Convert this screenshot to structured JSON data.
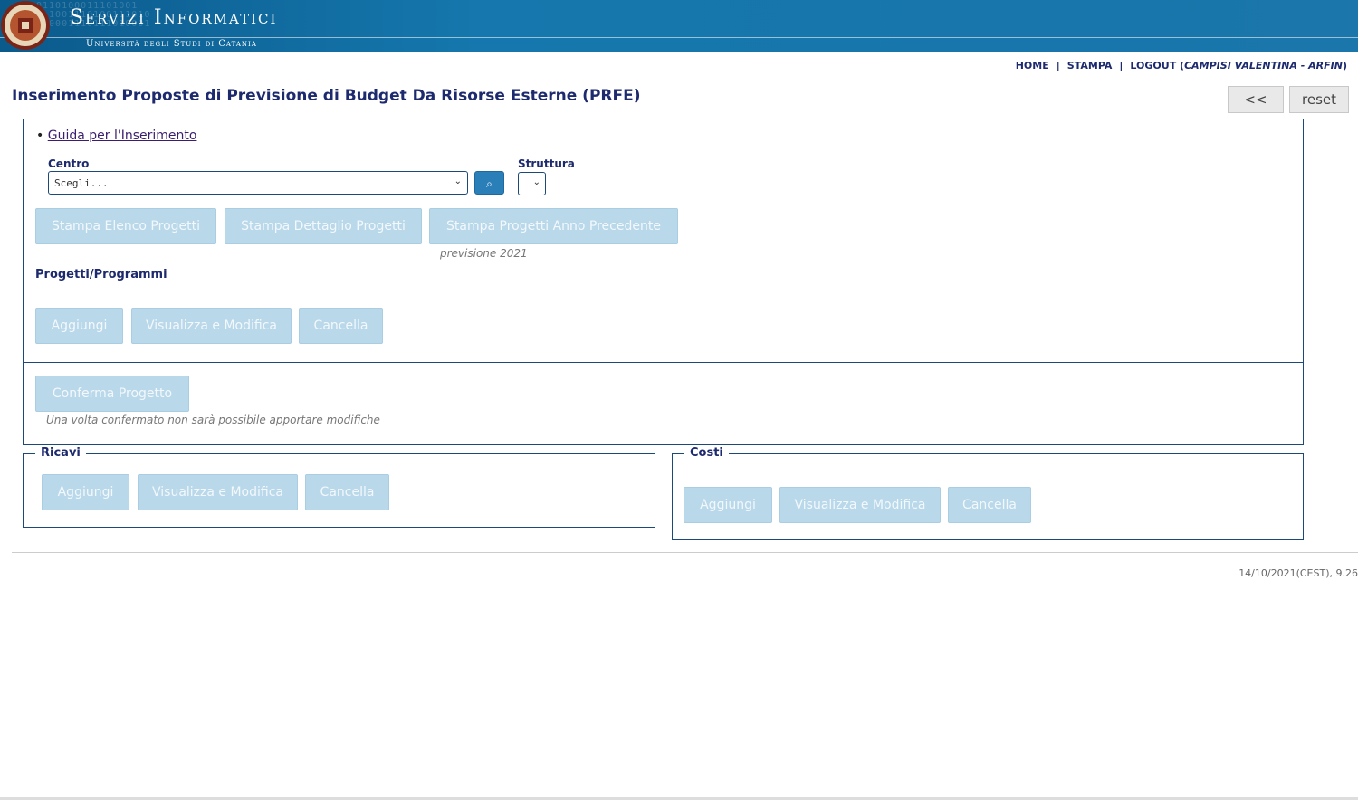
{
  "header": {
    "title": "Servizi Informatici",
    "subtitle": "Università degli Studi di Catania"
  },
  "topnav": {
    "home": "HOME",
    "stampa": "STAMPA",
    "logout": "LOGOUT",
    "user": "CAMPISI VALENTINA - ARFIN",
    "separator": "|"
  },
  "page": {
    "title": "Inserimento Proposte di Previsione di Budget Da Risorse Esterne (PRFE)",
    "back_button": "<<",
    "reset_button": "reset"
  },
  "form": {
    "guide_link": "Guida per l'Inserimento",
    "centro_label": "Centro",
    "centro_value": "Scegli...",
    "struttura_label": "Struttura",
    "stampa_elenco": "Stampa Elenco Progetti",
    "stampa_dettaglio": "Stampa Dettaglio Progetti",
    "stampa_anno_prec": "Stampa Progetti Anno Precedente",
    "anno_prec_note": "previsione 2021",
    "progetti_label": "Progetti/Programmi",
    "aggiungi": "Aggiungi",
    "visualizza": "Visualizza e Modifica",
    "cancella": "Cancella"
  },
  "confirm": {
    "button": "Conferma Progetto",
    "note": "Una volta confermato non sarà possibile apportare modifiche"
  },
  "ricavi": {
    "legend": "Ricavi",
    "aggiungi": "Aggiungi",
    "visualizza": "Visualizza e Modifica",
    "cancella": "Cancella"
  },
  "costi": {
    "legend": "Costi",
    "aggiungi": "Aggiungi",
    "visualizza": "Visualizza e Modifica",
    "cancella": "Cancella"
  },
  "footer": {
    "timestamp": "14/10/2021(CEST), 9.26"
  },
  "colors": {
    "banner": "#1577ad",
    "accent": "#1d2a6e",
    "disabled_button": "#b9d8ea"
  }
}
